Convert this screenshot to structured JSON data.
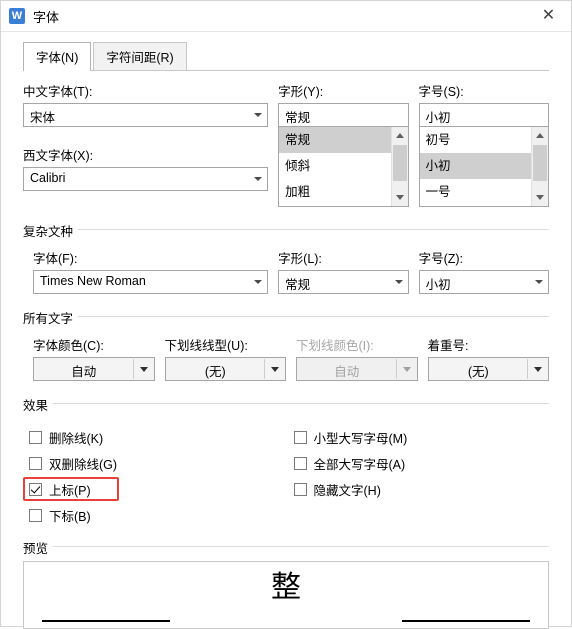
{
  "window": {
    "app_icon": "W",
    "title": "字体",
    "close_label": "✕"
  },
  "tabs": [
    {
      "label": "字体(N)",
      "active": true
    },
    {
      "label": "字符间距(R)",
      "active": false
    }
  ],
  "latin_section": {
    "chinese_font_label": "中文字体(T):",
    "chinese_font_value": "宋体",
    "western_font_label": "西文字体(X):",
    "western_font_value": "Calibri",
    "style_label": "字形(Y):",
    "style_value": "常规",
    "style_options": [
      "常规",
      "倾斜",
      "加粗"
    ],
    "style_selected": "常规",
    "size_label": "字号(S):",
    "size_value": "小初",
    "size_options": [
      "初号",
      "小初",
      "一号"
    ],
    "size_selected": "小初"
  },
  "complex_section": {
    "title": "复杂文种",
    "font_label": "字体(F):",
    "font_value": "Times New Roman",
    "style_label": "字形(L):",
    "style_value": "常规",
    "size_label": "字号(Z):",
    "size_value": "小初"
  },
  "all_text_section": {
    "title": "所有文字",
    "font_color_label": "字体颜色(C):",
    "font_color_value": "自动",
    "underline_style_label": "下划线线型(U):",
    "underline_style_value": "(无)",
    "underline_color_label": "下划线颜色(I):",
    "underline_color_value": "自动",
    "underline_color_disabled": true,
    "emphasis_label": "着重号:",
    "emphasis_value": "(无)"
  },
  "effects_section": {
    "title": "效果",
    "left": [
      {
        "label": "删除线(K)",
        "checked": false,
        "highlighted": false
      },
      {
        "label": "双删除线(G)",
        "checked": false,
        "highlighted": false
      },
      {
        "label": "上标(P)",
        "checked": true,
        "highlighted": true
      },
      {
        "label": "下标(B)",
        "checked": false,
        "highlighted": false
      }
    ],
    "right": [
      {
        "label": "小型大写字母(M)",
        "checked": false
      },
      {
        "label": "全部大写字母(A)",
        "checked": false
      },
      {
        "label": "隐藏文字(H)",
        "checked": false
      }
    ]
  },
  "preview_section": {
    "title": "预览",
    "sample_text": "整"
  },
  "colors": {
    "accent": "#3a7fd5",
    "highlight": "#e8403a",
    "selection": "#cfcfcf"
  }
}
